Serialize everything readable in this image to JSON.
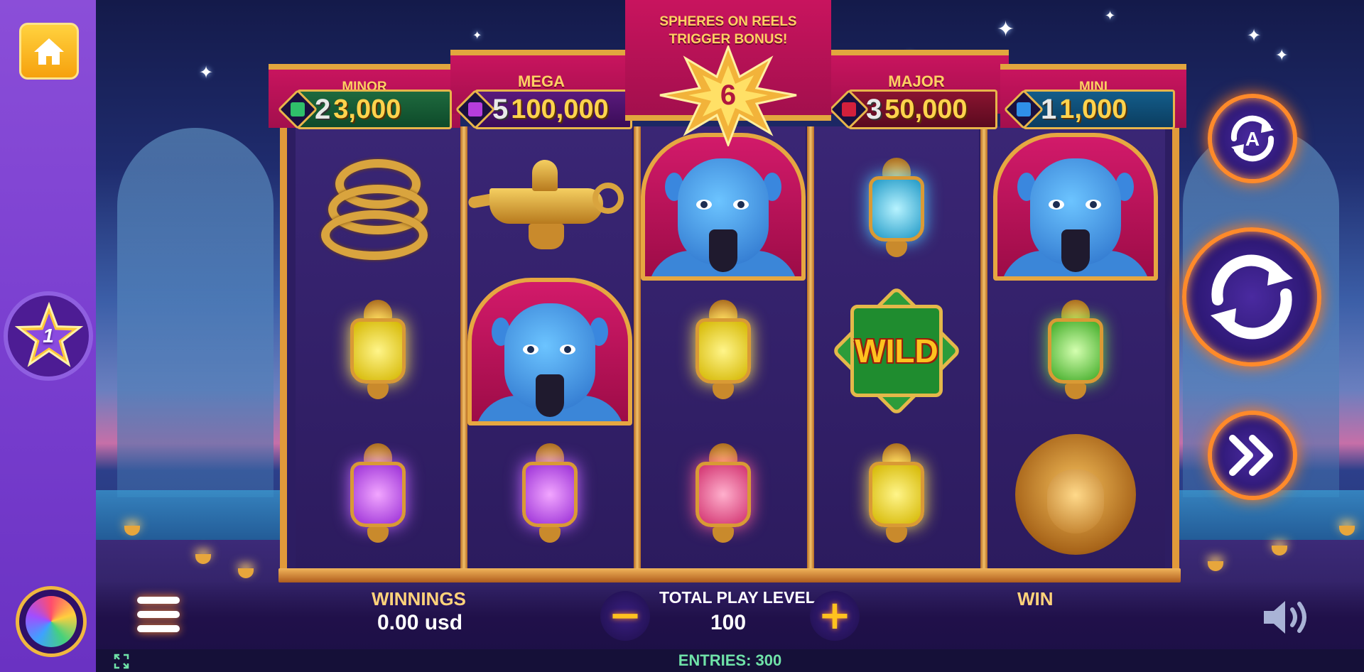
{
  "sidebar": {
    "home_label": "home",
    "level_number": "1"
  },
  "jackpots": {
    "minor": {
      "title": "MINOR",
      "count": "2",
      "amount": "3,000",
      "gem_color": "#2fbf6a"
    },
    "mega": {
      "title": "MEGA",
      "count": "5",
      "amount": "100,000",
      "gem_color": "#b53ddc"
    },
    "major": {
      "title": "MAJOR",
      "count": "3",
      "amount": "50,000",
      "gem_color": "#d3203c"
    },
    "mini": {
      "title": "MINI",
      "count": "1",
      "amount": "1,000",
      "gem_color": "#2f8fe8"
    }
  },
  "bonus_banner": {
    "line1": "SPHERES ON REELS",
    "line2": "TRIGGER BONUS!",
    "spheres_count": "6"
  },
  "reels": [
    [
      "golden-snake",
      "yellow-lantern",
      "purple-lantern"
    ],
    [
      "magic-lamp",
      "genie",
      "purple-lantern"
    ],
    [
      "genie",
      "yellow-lantern",
      "pink-lantern"
    ],
    [
      "blue-lantern",
      "wild",
      "yellow-lantern"
    ],
    [
      "genie",
      "green-lantern",
      "golden-lion"
    ]
  ],
  "wild_label": "WILD",
  "bottom": {
    "winnings_label": "WINNINGS",
    "winnings_value": "0.00 usd",
    "play_level_label": "TOTAL PLAY LEVEL",
    "play_level_value": "100",
    "win_label": "WIN",
    "minus_glyph": "−",
    "plus_glyph": "+",
    "entries_text": "ENTRIES: 300"
  },
  "controls": {
    "autoplay_letter": "A"
  },
  "colors": {
    "sidebar": "#7a3fd0",
    "accent_orange": "#ff8a2a",
    "gold": "#ffd34d",
    "jackpot_red": "#c8145e",
    "entries_green": "#6fe2a8"
  }
}
